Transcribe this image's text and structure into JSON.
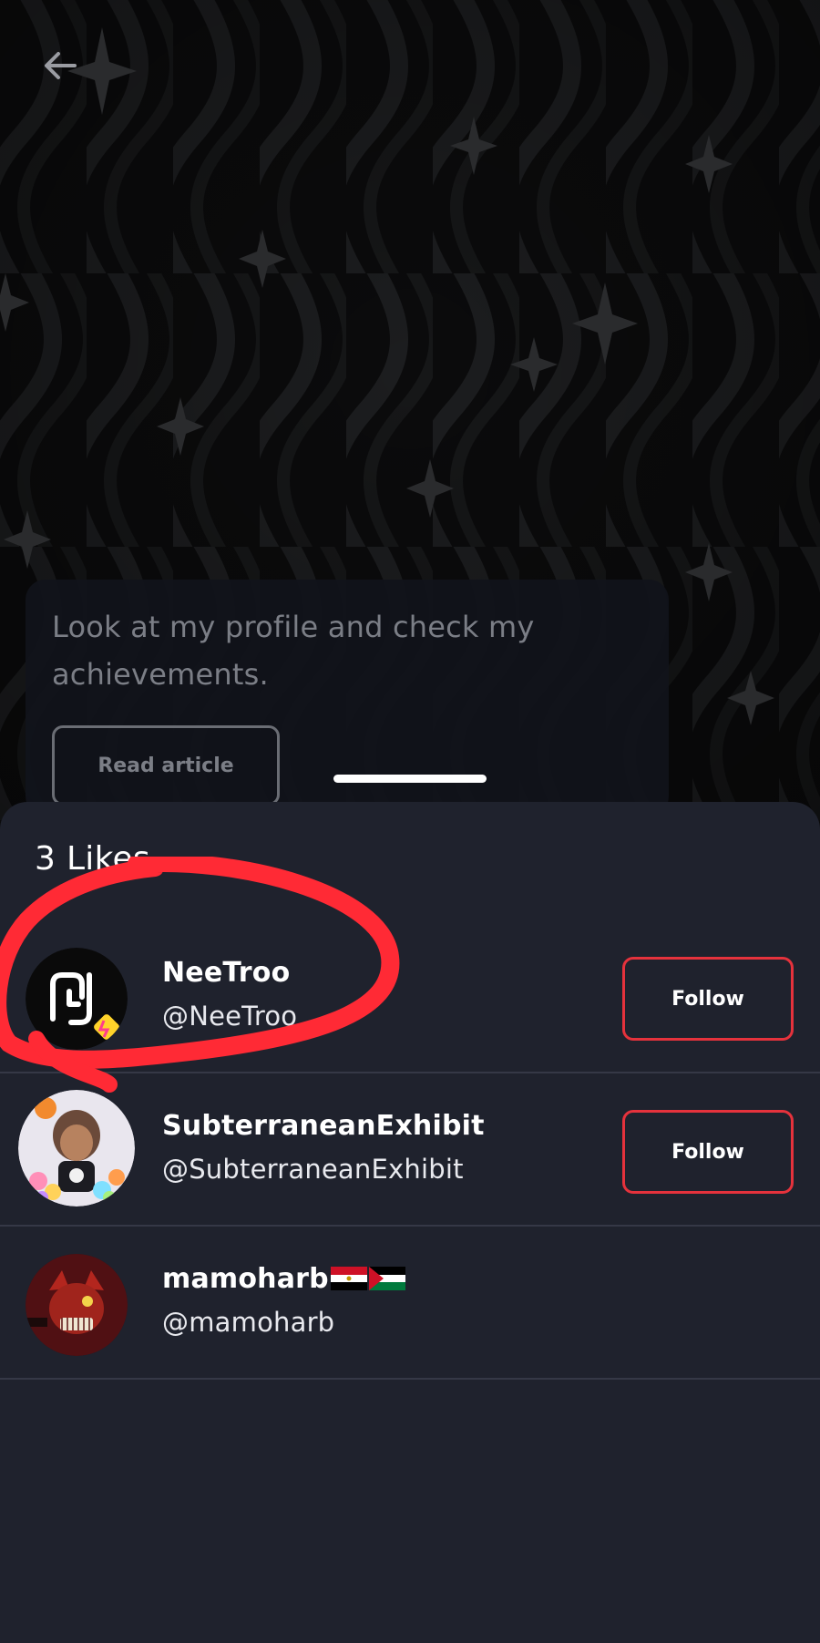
{
  "app": {
    "back_icon": "arrow-left-icon"
  },
  "article": {
    "text": "Look at my profile and check my achievements.",
    "read_label": "Read article"
  },
  "likes": {
    "title": "3 Likes",
    "users": [
      {
        "name": "NeeTroo",
        "handle": "@NeeTroo",
        "follow_label": "Follow",
        "avatar": "neetroo-logo-avatar"
      },
      {
        "name": "SubterraneanExhibit",
        "handle": "@SubterraneanExhibit",
        "follow_label": "Follow",
        "avatar": "character-with-flowers-avatar"
      },
      {
        "name": "mamoharb",
        "handle": "@mamoharb",
        "flags": [
          "egypt-flag-icon",
          "palestine-flag-icon"
        ],
        "avatar": "red-animatronic-avatar"
      }
    ]
  },
  "colors": {
    "background": "#0b0b0c",
    "sheet": "#1f222d",
    "follow_border": "#e5323c",
    "annotation": "#ff2a35"
  }
}
